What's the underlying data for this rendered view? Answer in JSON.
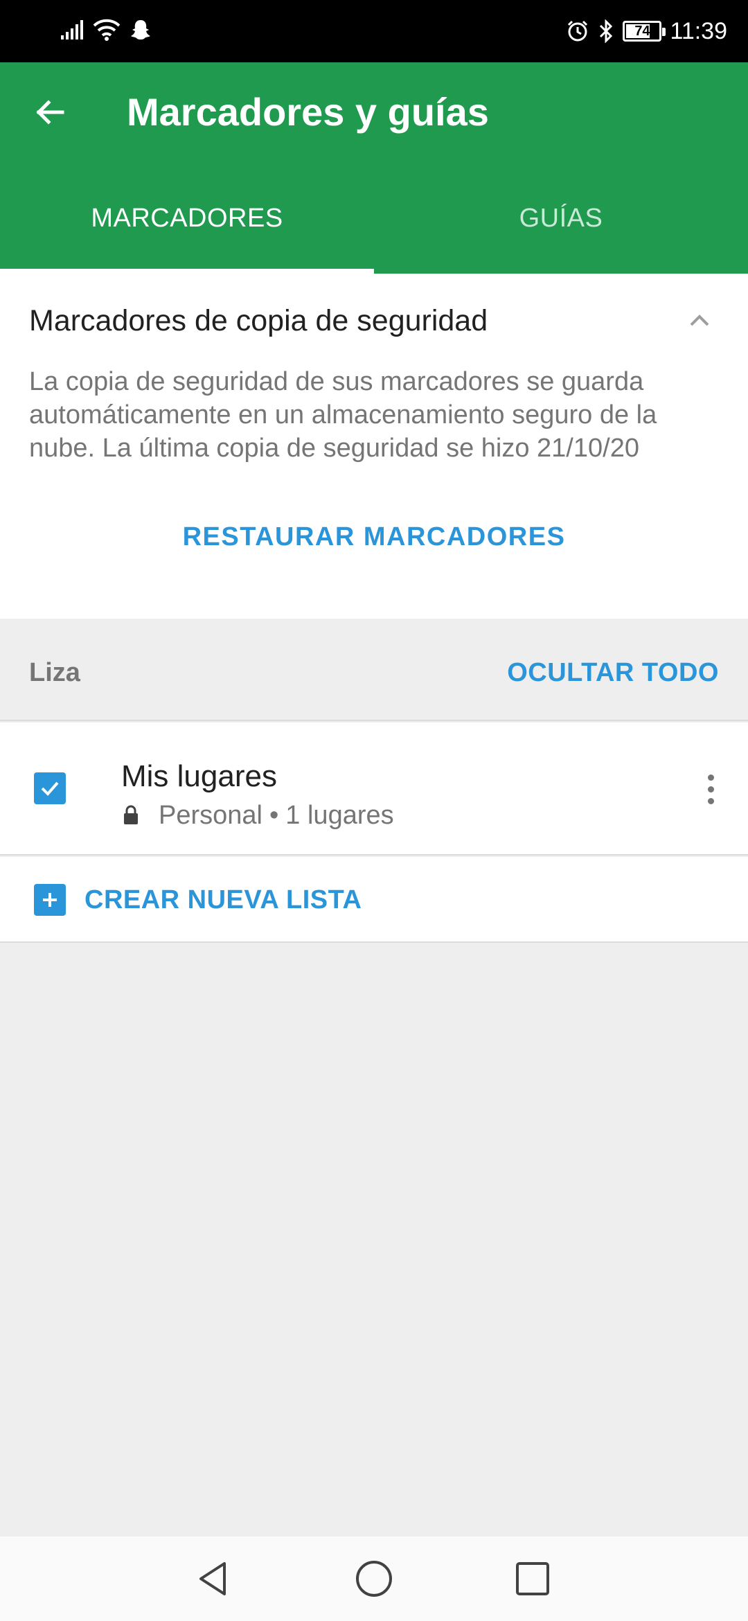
{
  "status_bar": {
    "time": "11:39",
    "battery_level": "74",
    "battery_fraction": 0.74,
    "left_icons": [
      "signal-icon",
      "wifi-icon",
      "snapchat-icon"
    ],
    "right_icons": [
      "alarm-icon",
      "bluetooth-icon",
      "battery-icon"
    ]
  },
  "app_bar": {
    "title": "Marcadores y guías",
    "back_icon": "arrow-back-icon",
    "color": "#1f9a4e"
  },
  "tabs": [
    {
      "label": "MARCADORES",
      "selected": true
    },
    {
      "label": "GUÍAS",
      "selected": false
    }
  ],
  "backup": {
    "title": "Marcadores de copia de seguridad",
    "description": "La copia de seguridad de sus marcadores se guarda automáticamente en un almacenamiento seguro de la nube. La última copia de seguridad se hizo 21/10/20",
    "restore_label": "RESTAURAR MARCADORES",
    "expanded": true
  },
  "lists_header": {
    "label": "Liza",
    "hide_all_label": "OCULTAR TODO"
  },
  "lists": [
    {
      "title": "Mis lugares",
      "privacy": "Personal",
      "separator": "•",
      "count": "1 lugares",
      "checked": true
    }
  ],
  "create_list": {
    "label": "CREAR NUEVA LISTA"
  },
  "accent_color": "#2b95d9",
  "nav_bar": {
    "icons": [
      "nav-back-icon",
      "nav-home-icon",
      "nav-recents-icon"
    ]
  }
}
